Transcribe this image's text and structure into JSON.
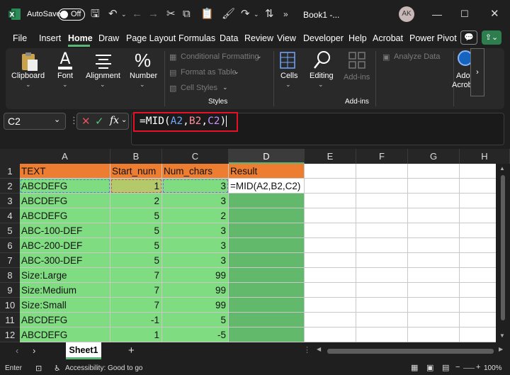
{
  "titlebar": {
    "autosave_label": "AutoSave",
    "autosave_state": "Off",
    "doc_title": "Book1  -...",
    "avatar_initials": "AK"
  },
  "menu": {
    "items": [
      "File",
      "Insert",
      "Home",
      "Draw",
      "Page Layout",
      "Formulas",
      "Data",
      "Review",
      "View",
      "Developer",
      "Help",
      "Acrobat",
      "Power Pivot"
    ],
    "active": "Home"
  },
  "ribbon": {
    "clipboard": "Clipboard",
    "font": "Font",
    "alignment": "Alignment",
    "number": "Number",
    "conditional_formatting": "Conditional Formatting",
    "format_as_table": "Format as Table",
    "cell_styles": "Cell Styles",
    "styles_group": "Styles",
    "cells": "Cells",
    "editing": "Editing",
    "addins_button": "Add-ins",
    "addins_group": "Add-ins",
    "analyze_data": "Analyze Data",
    "adobe_line1": "Adob",
    "adobe_line2": "Acrob"
  },
  "formula_bar": {
    "name_box": "C2",
    "fx_label": "fx",
    "formula_prefix": "=MID(",
    "ref1": "A2",
    "ref2": "B2",
    "ref3": "C2",
    "comma": ",",
    "formula_suffix": ")"
  },
  "grid": {
    "columns": [
      "A",
      "B",
      "C",
      "D",
      "E",
      "F",
      "G",
      "H"
    ],
    "rows": [
      "1",
      "2",
      "3",
      "4",
      "5",
      "6",
      "7",
      "8",
      "9",
      "10",
      "11",
      "12"
    ],
    "header": [
      "TEXT",
      "Start_num",
      "Num_chars",
      "Result"
    ],
    "data": [
      [
        "ABCDEFG",
        "1",
        "3",
        "=MID(A2,B2,C2)"
      ],
      [
        "ABCDEFG",
        "2",
        "3",
        ""
      ],
      [
        "ABCDEFG",
        "5",
        "2",
        ""
      ],
      [
        "ABC-100-DEF",
        "5",
        "3",
        ""
      ],
      [
        "ABC-200-DEF",
        "5",
        "3",
        ""
      ],
      [
        "ABC-300-DEF",
        "5",
        "3",
        ""
      ],
      [
        "Size:Large",
        "7",
        "99",
        ""
      ],
      [
        "Size:Medium",
        "7",
        "99",
        ""
      ],
      [
        "Size:Small",
        "7",
        "99",
        ""
      ],
      [
        "ABCDEFG",
        "-1",
        "5",
        ""
      ],
      [
        "ABCDEFG",
        "1",
        "-5",
        ""
      ]
    ],
    "colors": {
      "header": "#ed7d31",
      "data": "#7fdc80",
      "result": "#62b96b"
    }
  },
  "tabs": {
    "sheet": "Sheet1"
  },
  "status": {
    "mode": "Enter",
    "accessibility": "Accessibility: Good to go",
    "zoom": "100%"
  }
}
